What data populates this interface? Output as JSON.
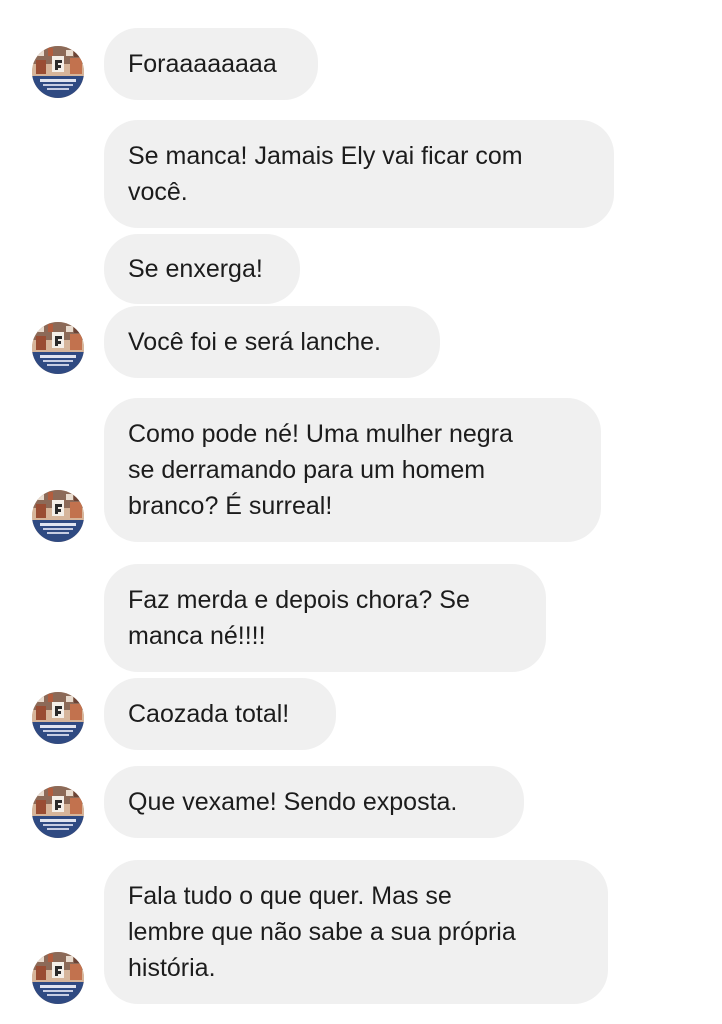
{
  "messages": [
    {
      "text": "Foraaaaaaaa"
    },
    {
      "text": "Se manca! Jamais Ely vai ficar com\nvocê."
    },
    {
      "text": "Se enxerga!"
    },
    {
      "text": "Você foi e será lanche."
    },
    {
      "text": "Como pode né! Uma mulher negra\nse derramando para um homem\nbranco? É surreal!"
    },
    {
      "text": "Faz merda e depois chora? Se\nmanca né!!!!"
    },
    {
      "text": "Caozada total!"
    },
    {
      "text": "Que vexame! Sendo exposta."
    },
    {
      "text": "Fala tudo o que quer. Mas se\nlembre que não sabe a sua própria\nhistória."
    }
  ],
  "colors": {
    "bubble_bg": "#f0f0f0",
    "text": "#1c1c1c",
    "page_bg": "#ffffff"
  },
  "icons": {
    "avatar": "profile-picture-icon"
  }
}
